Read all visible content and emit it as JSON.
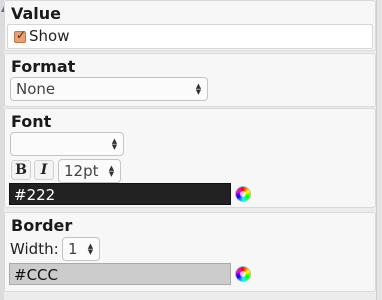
{
  "value": {
    "title": "Value",
    "show_label": "Show",
    "show_checked": true
  },
  "format": {
    "title": "Format",
    "selected": "None"
  },
  "font": {
    "title": "Font",
    "family_selected": "",
    "bold_label": "B",
    "italic_label": "I",
    "size_selected": "12pt",
    "color_value": "#222"
  },
  "border": {
    "title": "Border",
    "width_label": "Width:",
    "width_selected": "1",
    "color_value": "#CCC"
  },
  "icons": {
    "collapse": "triangle-up-icon",
    "color_picker": "color-wheel-icon",
    "checkbox_tick": "check-icon",
    "spinner": "up-down-arrows-icon"
  },
  "colors": {
    "font_swatch_bg": "#222222",
    "border_swatch_bg": "#cccccc",
    "checkbox_fill": "#e8a070"
  }
}
